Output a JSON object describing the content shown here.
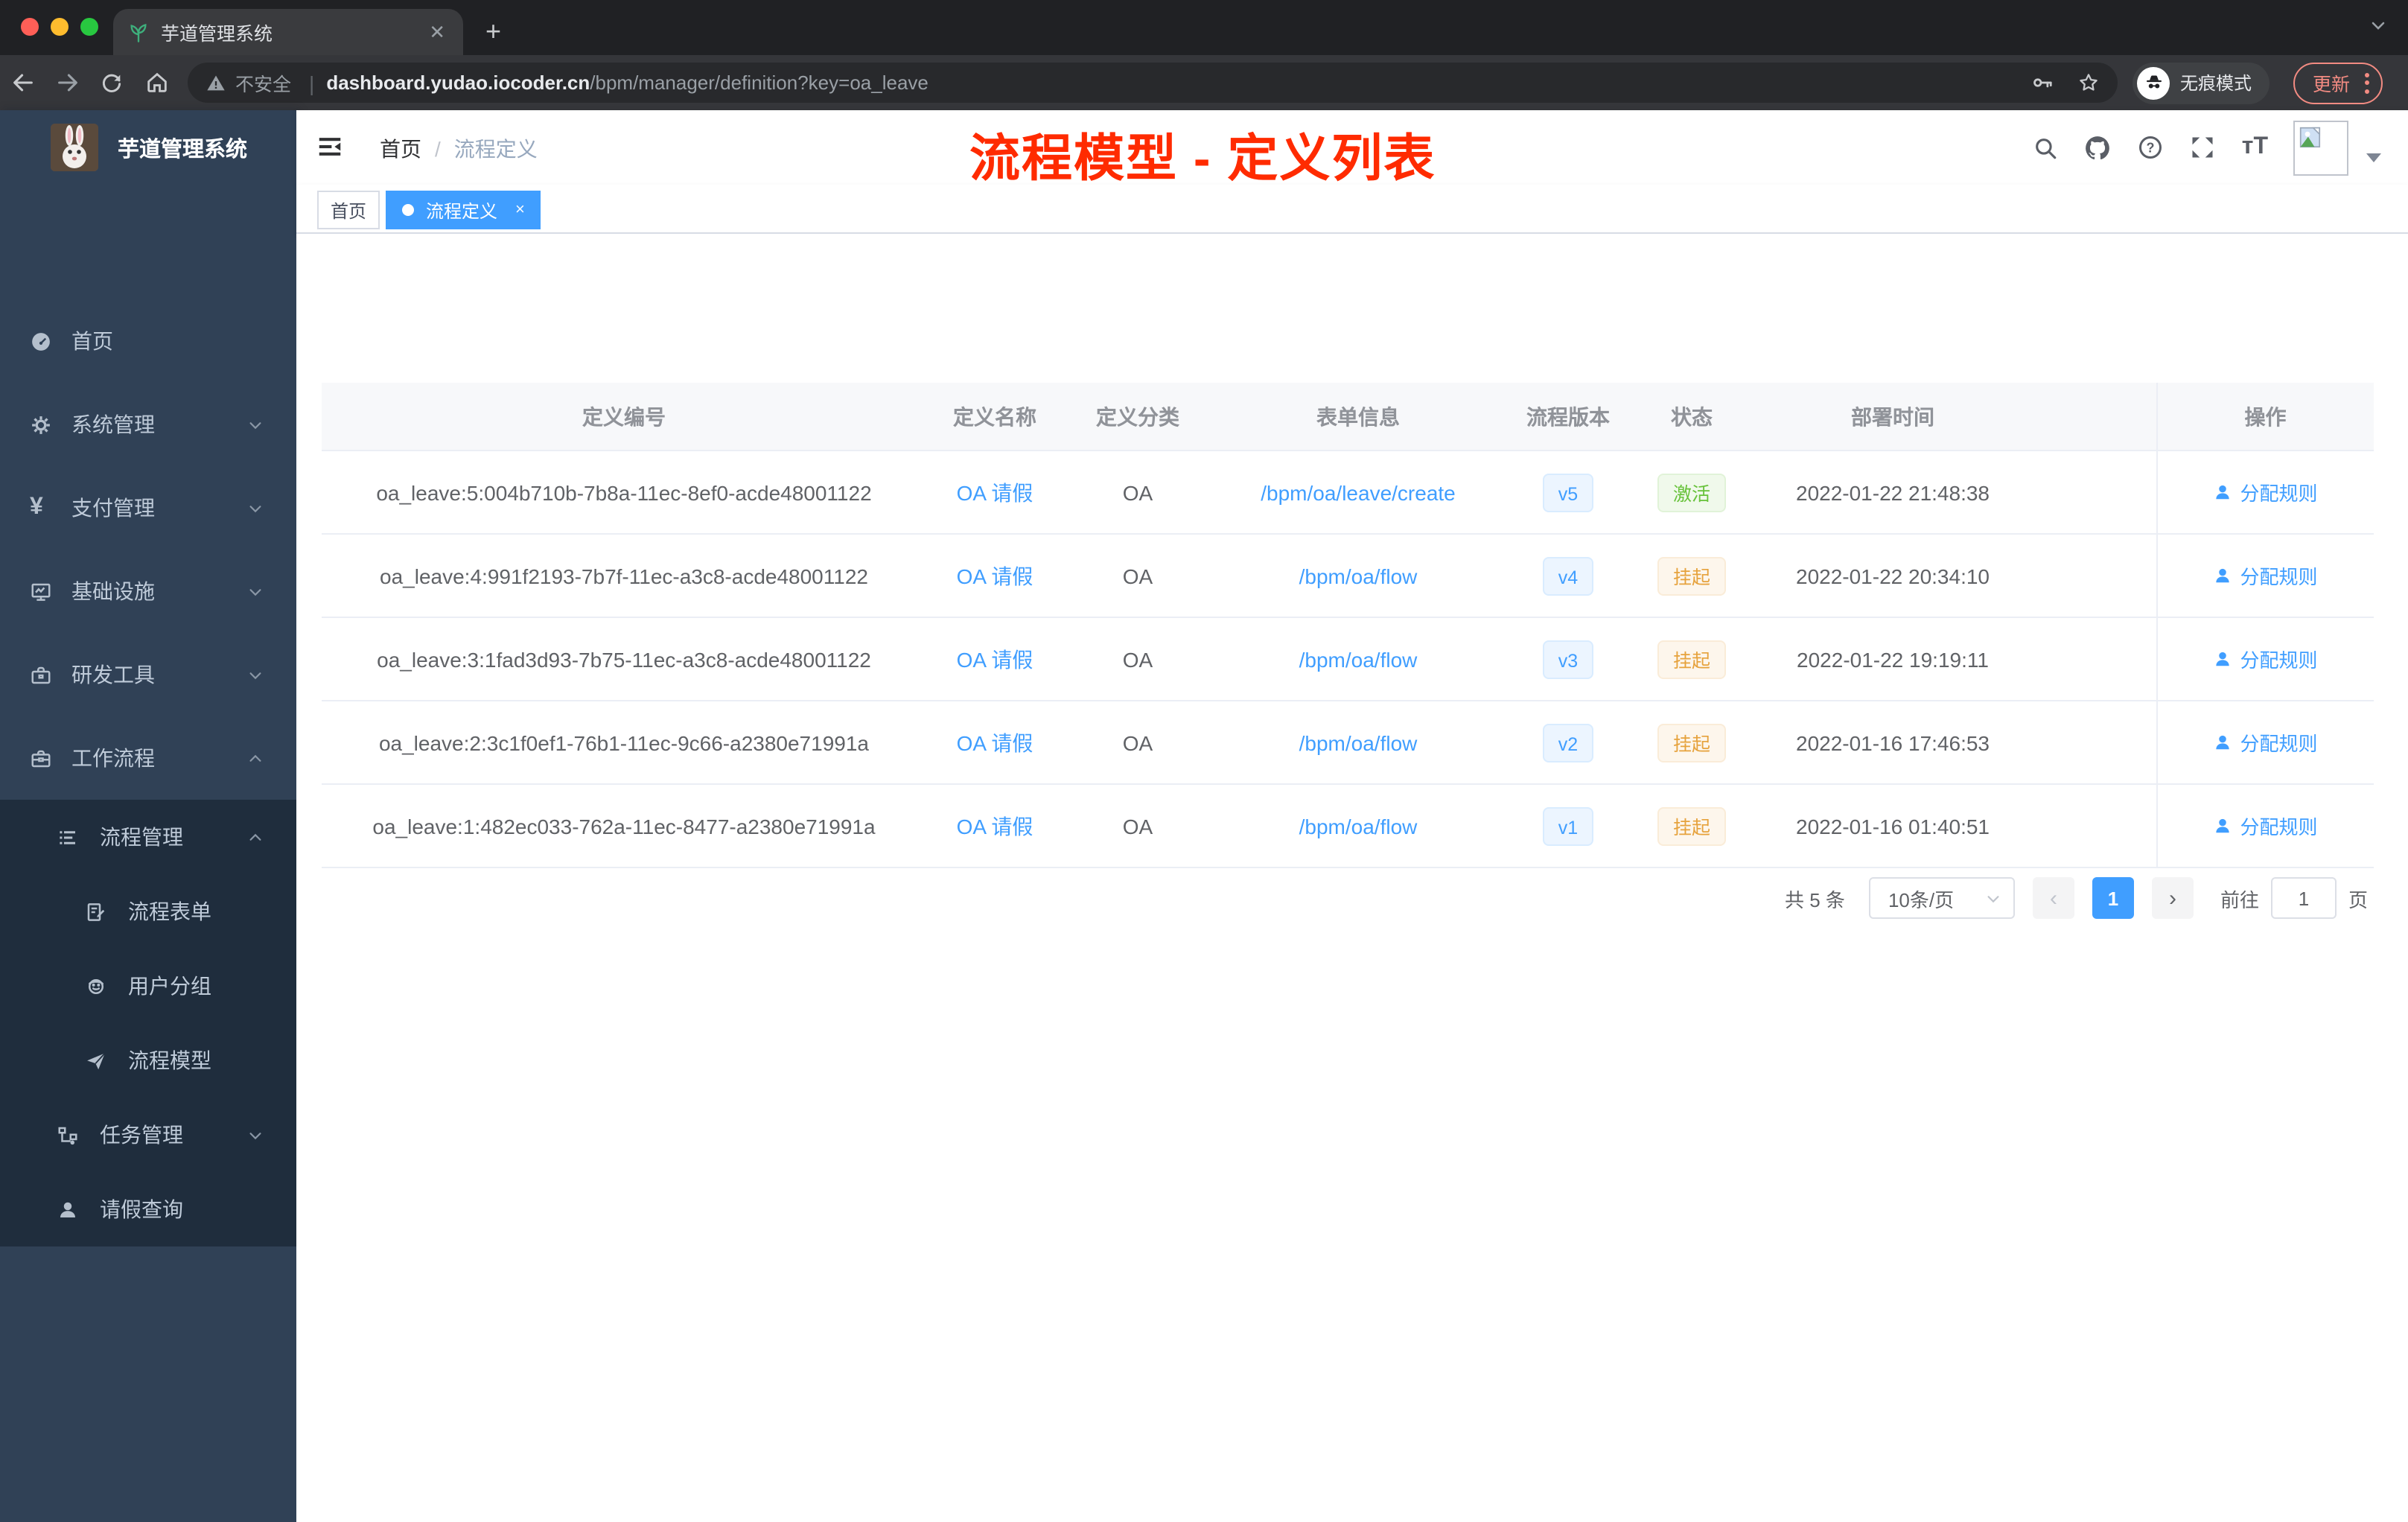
{
  "colors": {
    "accent": "#409eff",
    "success": "#67c23a",
    "warning": "#e6a23c",
    "annotation_red": "#ff2b00",
    "sidebar_bg": "#304156",
    "submenu_bg": "#1f2d3d",
    "update_pill": "#f28b82"
  },
  "browser": {
    "tab_title": "芋道管理系统",
    "tab_close": "✕",
    "new_tab": "+",
    "security": "不安全",
    "url_host": "dashboard.yudao.iocoder.cn",
    "url_path": "/bpm/manager/definition?key=oa_leave",
    "incognito": "无痕模式",
    "update": "更新"
  },
  "sidebar": {
    "logo_title": "芋道管理系统",
    "items": [
      {
        "label": "首页",
        "icon": "dashboard-icon"
      },
      {
        "label": "系统管理",
        "icon": "gear-icon",
        "arrow": "down"
      },
      {
        "label": "支付管理",
        "icon": "yen-icon",
        "arrow": "down",
        "yen": "¥"
      },
      {
        "label": "基础设施",
        "icon": "monitor-icon",
        "arrow": "down"
      },
      {
        "label": "研发工具",
        "icon": "toolbox-icon",
        "arrow": "down"
      },
      {
        "label": "工作流程",
        "icon": "briefcase-icon",
        "arrow": "up"
      }
    ],
    "workflow_children": [
      {
        "label": "流程管理",
        "icon": "list-icon",
        "arrow": "up"
      },
      {
        "label": "流程表单",
        "icon": "form-icon"
      },
      {
        "label": "用户分组",
        "icon": "user-group-icon"
      },
      {
        "label": "流程模型",
        "icon": "send-icon"
      },
      {
        "label": "任务管理",
        "icon": "tree-icon",
        "arrow": "down"
      },
      {
        "label": "请假查询",
        "icon": "user-icon"
      }
    ]
  },
  "header": {
    "breadcrumb": [
      "首页",
      "流程定义"
    ],
    "separator": "/",
    "annotation": "流程模型 - 定义列表"
  },
  "tags": [
    {
      "label": "首页",
      "active": false
    },
    {
      "label": "流程定义",
      "active": true,
      "close": "×"
    }
  ],
  "table": {
    "columns": [
      "定义编号",
      "定义名称",
      "定义分类",
      "表单信息",
      "流程版本",
      "状态",
      "部署时间",
      "操作"
    ],
    "rows": [
      {
        "id": "oa_leave:5:004b710b-7b8a-11ec-8ef0-acde48001122",
        "name": "OA 请假",
        "category": "OA",
        "form": "/bpm/oa/leave/create",
        "version": "v5",
        "status": "激活",
        "status_type": "success",
        "deployed_at": "2022-01-22 21:48:38",
        "action": "分配规则"
      },
      {
        "id": "oa_leave:4:991f2193-7b7f-11ec-a3c8-acde48001122",
        "name": "OA 请假",
        "category": "OA",
        "form": "/bpm/oa/flow",
        "version": "v4",
        "status": "挂起",
        "status_type": "warning",
        "deployed_at": "2022-01-22 20:34:10",
        "action": "分配规则"
      },
      {
        "id": "oa_leave:3:1fad3d93-7b75-11ec-a3c8-acde48001122",
        "name": "OA 请假",
        "category": "OA",
        "form": "/bpm/oa/flow",
        "version": "v3",
        "status": "挂起",
        "status_type": "warning",
        "deployed_at": "2022-01-22 19:19:11",
        "action": "分配规则"
      },
      {
        "id": "oa_leave:2:3c1f0ef1-76b1-11ec-9c66-a2380e71991a",
        "name": "OA 请假",
        "category": "OA",
        "form": "/bpm/oa/flow",
        "version": "v2",
        "status": "挂起",
        "status_type": "warning",
        "deployed_at": "2022-01-16 17:46:53",
        "action": "分配规则"
      },
      {
        "id": "oa_leave:1:482ec033-762a-11ec-8477-a2380e71991a",
        "name": "OA 请假",
        "category": "OA",
        "form": "/bpm/oa/flow",
        "version": "v1",
        "status": "挂起",
        "status_type": "warning",
        "deployed_at": "2022-01-16 01:40:51",
        "action": "分配规则"
      }
    ]
  },
  "pagination": {
    "total": "共 5 条",
    "page_size": "10条/页",
    "prev": "‹",
    "page": "1",
    "next": "›",
    "goto_label": "前往",
    "goto_value": "1",
    "unit": "页"
  }
}
